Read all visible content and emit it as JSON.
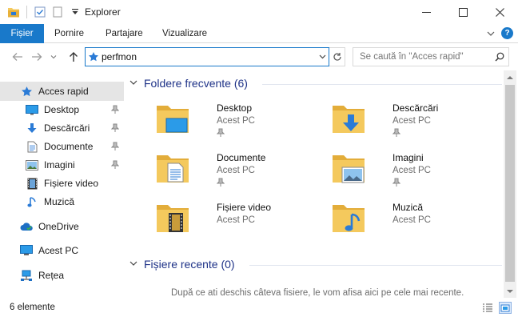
{
  "window": {
    "title": "Explorer"
  },
  "ribbon": {
    "tabs": [
      "Fișier",
      "Pornire",
      "Partajare",
      "Vizualizare"
    ]
  },
  "address": {
    "value": "perfmon"
  },
  "search": {
    "placeholder": "Se caută în \"Acces rapid\""
  },
  "sidebar": {
    "items": [
      {
        "label": "Acces rapid",
        "icon": "star-icon",
        "pinned": false
      },
      {
        "label": "Desktop",
        "icon": "desktop-icon",
        "pinned": true
      },
      {
        "label": "Descărcări",
        "icon": "download-icon",
        "pinned": true
      },
      {
        "label": "Documente",
        "icon": "document-icon",
        "pinned": true
      },
      {
        "label": "Imagini",
        "icon": "picture-icon",
        "pinned": true
      },
      {
        "label": "Fișiere video",
        "icon": "film-icon",
        "pinned": false
      },
      {
        "label": "Muzică",
        "icon": "music-icon",
        "pinned": false
      },
      {
        "label": "OneDrive",
        "icon": "cloud-icon",
        "pinned": false
      },
      {
        "label": "Acest PC",
        "icon": "computer-icon",
        "pinned": false
      },
      {
        "label": "Rețea",
        "icon": "network-icon",
        "pinned": false
      }
    ]
  },
  "main": {
    "frequent_header": "Foldere frecvente (6)",
    "recent_header": "Fișiere recente (0)",
    "empty_message": "După ce ati deschis câteva fisiere, le vom afisa aici pe cele mai recente.",
    "folders": [
      {
        "name": "Desktop",
        "location": "Acest PC",
        "pinned": true,
        "overlay": "desktop"
      },
      {
        "name": "Descărcări",
        "location": "Acest PC",
        "pinned": true,
        "overlay": "download"
      },
      {
        "name": "Documente",
        "location": "Acest PC",
        "pinned": true,
        "overlay": "document"
      },
      {
        "name": "Imagini",
        "location": "Acest PC",
        "pinned": true,
        "overlay": "picture"
      },
      {
        "name": "Fișiere video",
        "location": "Acest PC",
        "pinned": false,
        "overlay": "film"
      },
      {
        "name": "Muzică",
        "location": "Acest PC",
        "pinned": false,
        "overlay": "music"
      }
    ]
  },
  "status": {
    "count": "6 elemente"
  },
  "colors": {
    "accent": "#1979ca",
    "folder": "#f4c95d",
    "header_text": "#1e3287"
  }
}
